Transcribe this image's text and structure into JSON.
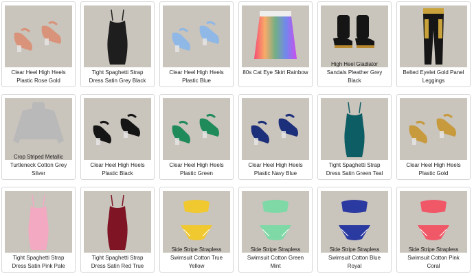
{
  "colors": {
    "background": "#c9c4bc",
    "border": "#d6d6d6",
    "text": "#222222"
  },
  "items": [
    {
      "caption_1": "Clear Heel High Heels",
      "caption_2": "Plastic Rose Gold",
      "icon": "heels-icon",
      "color": "#d9937a"
    },
    {
      "caption_1": "Tight Spaghetti Strap",
      "caption_2": "Dress Satin Grey Black",
      "icon": "dress-icon",
      "color": "#1e1e1e"
    },
    {
      "caption_1": "Clear Heel High Heels",
      "caption_2": "Plastic Blue",
      "icon": "heels-icon",
      "color": "#8fb8e6"
    },
    {
      "caption_1": "80s Cat Eye Skirt Rainbow",
      "caption_2": "",
      "icon": "skirt-icon",
      "color": "#e94ec8"
    },
    {
      "overlay": "High Heel Gladiator",
      "caption_1": "Sandals Pleather Grey",
      "caption_2": "Black",
      "icon": "sandals-icon",
      "color": "#151515"
    },
    {
      "caption_1": "Belted Eyelet Gold Panel",
      "caption_2": "Leggings",
      "icon": "leggings-icon",
      "color": "#161616"
    },
    {
      "overlay": "Crop Striped Metallic",
      "caption_1": "Turtleneck Cotton Grey",
      "caption_2": "Silver",
      "icon": "turtleneck-icon",
      "color": "#b9b9b9"
    },
    {
      "caption_1": "Clear Heel High Heels",
      "caption_2": "Plastic Black",
      "icon": "heels-icon",
      "color": "#151515"
    },
    {
      "caption_1": "Clear Heel High Heels",
      "caption_2": "Plastic Green",
      "icon": "heels-icon",
      "color": "#1f8a5a"
    },
    {
      "caption_1": "Clear Heel High Heels",
      "caption_2": "Plastic Navy Blue",
      "icon": "heels-icon",
      "color": "#1c2f7a"
    },
    {
      "caption_1": "Tight Spaghetti Strap",
      "caption_2": "Dress Satin Green Teal",
      "icon": "dress-icon",
      "color": "#0c5e64"
    },
    {
      "caption_1": "Clear Heel High Heels",
      "caption_2": "Plastic Gold",
      "icon": "heels-icon",
      "color": "#c79a3d"
    },
    {
      "caption_1": "Tight Spaghetti Strap",
      "caption_2": "Dress Satin Pink Pale",
      "icon": "dress-icon",
      "color": "#f3a9c2"
    },
    {
      "caption_1": "Tight Spaghetti Strap",
      "caption_2": "Dress Satin Red True",
      "icon": "dress-icon",
      "color": "#7e1424"
    },
    {
      "overlay": "Side Stripe Strapless",
      "caption_1": "Swimsuit Cotton True",
      "caption_2": "Yellow",
      "icon": "swimsuit-icon",
      "color": "#f0c830"
    },
    {
      "overlay": "Side Stripe Strapless",
      "caption_1": "Swimsuit Cotton Green",
      "caption_2": "Mint",
      "icon": "swimsuit-icon",
      "color": "#7fd9a6"
    },
    {
      "overlay": "Side Stripe Strapless",
      "caption_1": "Swimsuit Cotton Blue",
      "caption_2": "Royal",
      "icon": "swimsuit-icon",
      "color": "#2b3aa0"
    },
    {
      "overlay": "Side Stripe Strapless",
      "caption_1": "Swimsuit Cotton Pink",
      "caption_2": "Coral",
      "icon": "swimsuit-icon",
      "color": "#f05868"
    }
  ]
}
